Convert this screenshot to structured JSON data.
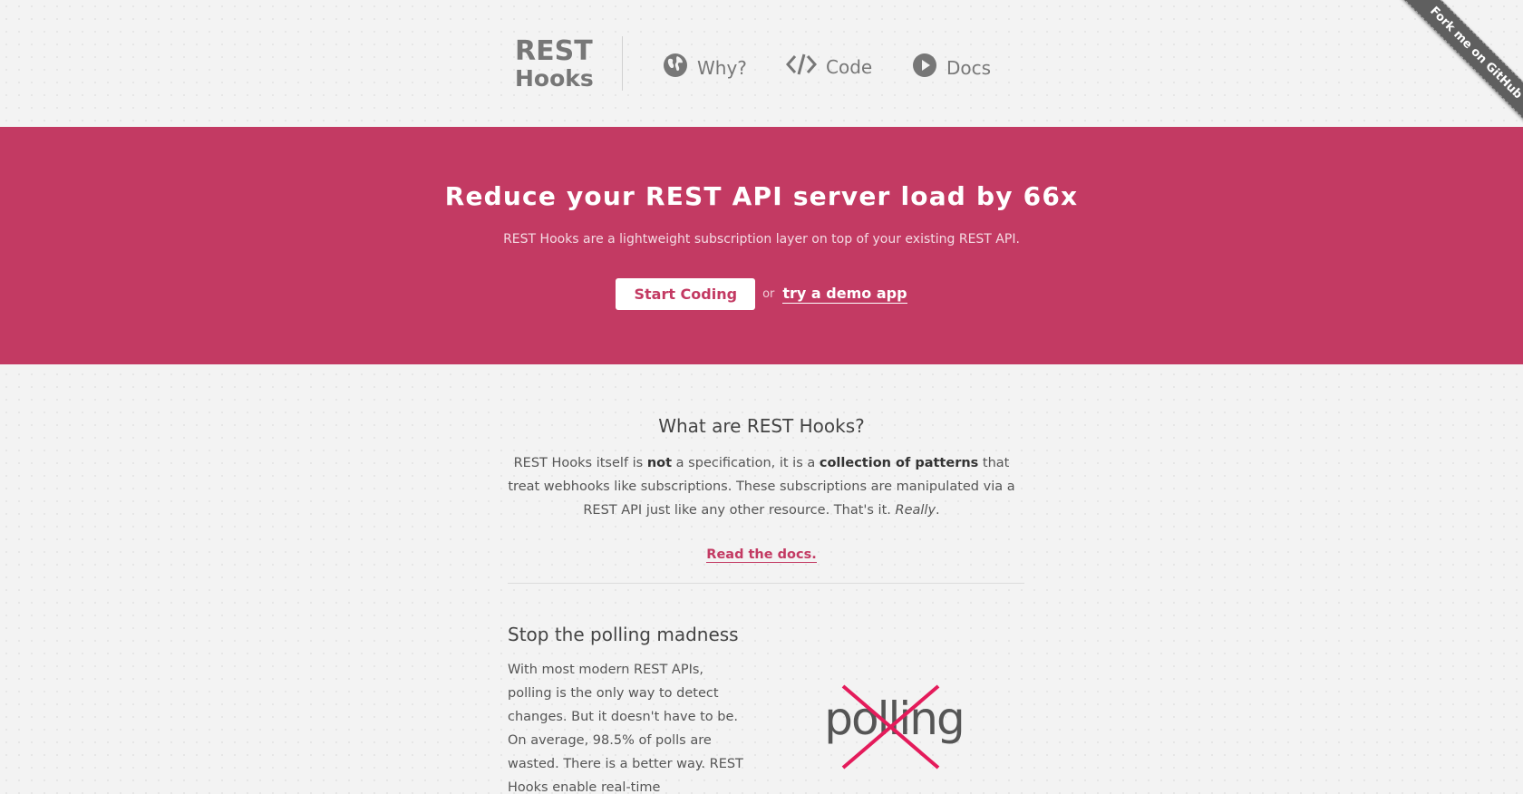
{
  "header": {
    "logo_line1": "REST",
    "logo_line2": "Hooks",
    "nav": [
      {
        "label": "Why?",
        "icon": "globe-icon"
      },
      {
        "label": "Code",
        "icon": "code-icon"
      },
      {
        "label": "Docs",
        "icon": "play-icon"
      }
    ],
    "ribbon": "Fork me on GitHub"
  },
  "hero": {
    "title": "Reduce your REST API server load by 66x",
    "subtitle": "REST Hooks are a lightweight subscription layer on top of your existing REST API.",
    "primary_button": "Start Coding",
    "or_text": "or",
    "secondary_link": "try a demo app"
  },
  "what": {
    "title": "What are REST Hooks?",
    "p1": "REST Hooks itself is ",
    "p_not": "not",
    "p2": " a specification, it is a ",
    "p_collection": "collection of patterns",
    "p3": " that treat webhooks like subscriptions. These subscriptions are manipulated via a REST API just like any other resource. That's it. ",
    "p_really": "Really",
    "p4": ".",
    "link": "Read the docs."
  },
  "polling": {
    "title": "Stop the polling madness",
    "text": "With most modern REST APIs, polling is the only way to detect changes. But it doesn't have to be. On average, 98.5% of polls are wasted. There is a better way. REST Hooks enable real-time communication and eliminate",
    "image_word": "polling"
  },
  "colors": {
    "accent": "#c33a63",
    "nav_text": "#777777",
    "ribbon": "#5f5f5f"
  }
}
